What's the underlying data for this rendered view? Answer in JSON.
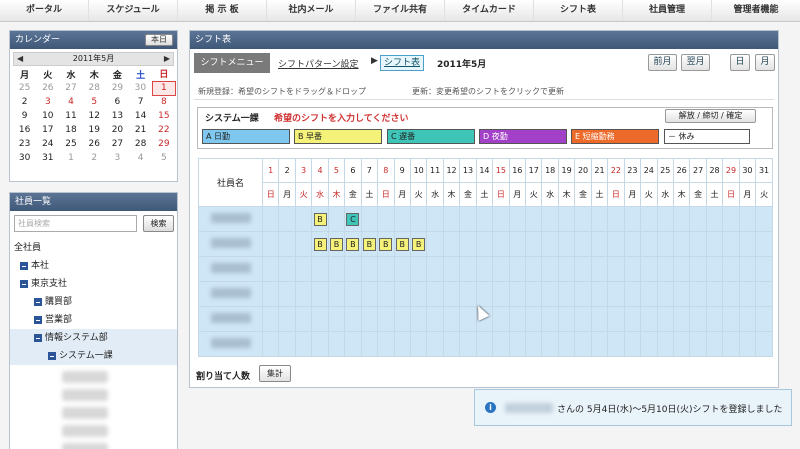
{
  "nav": [
    "ポータル",
    "スケジュール",
    "掲 示 板",
    "社内メール",
    "ファイル共有",
    "タイムカード",
    "シフト表",
    "社員管理",
    "管理者機能"
  ],
  "calendar": {
    "title": "カレンダー",
    "today_btn": "本日",
    "month": "2011年5月",
    "prev": "◀",
    "next": "▶",
    "weekdays": [
      "月",
      "火",
      "水",
      "木",
      "金",
      "土",
      "日"
    ],
    "weeks": [
      [
        "25",
        "26",
        "27",
        "28",
        "29",
        "30",
        "1"
      ],
      [
        "2",
        "3",
        "4",
        "5",
        "6",
        "7",
        "8"
      ],
      [
        "9",
        "10",
        "11",
        "12",
        "13",
        "14",
        "15"
      ],
      [
        "16",
        "17",
        "18",
        "19",
        "20",
        "21",
        "22"
      ],
      [
        "23",
        "24",
        "25",
        "26",
        "27",
        "28",
        "29"
      ],
      [
        "30",
        "31",
        "1",
        "2",
        "3",
        "4",
        "5"
      ]
    ]
  },
  "employees": {
    "title": "社員一覧",
    "search_placeholder": "社員検索",
    "search_btn": "検索",
    "tree": [
      "全社員",
      "本社",
      "東京支社",
      "購買部",
      "営業部",
      "情報システム部",
      "システム一課"
    ]
  },
  "shift": {
    "title": "シフト表",
    "menu": "シフトメニュー",
    "pattern_link": "シフトパターン設定",
    "arrow": "▶",
    "active_tab": "シフト表",
    "month": "2011年5月",
    "prev_month": "前月",
    "next_month": "翌月",
    "day_btn": "日",
    "month_btn": "月",
    "help_new": "新規登録：希望のシフトをドラッグ＆ドロップ",
    "help_update": "更新：変更希望のシフトをクリックで更新",
    "group": "システム一課",
    "instruction": "希望のシフトを入力してください",
    "approve_btn": "解放 / 締切 / 確定",
    "patterns": [
      {
        "label": "A 日勤",
        "color": "#7ec8f0"
      },
      {
        "label": "B 早番",
        "color": "#f5f27a"
      },
      {
        "label": "C 遅番",
        "color": "#3fc4b8"
      },
      {
        "label": "D 夜勤",
        "color": "#a340c8"
      },
      {
        "label": "E 短縮勤務",
        "color": "#ee6a2a"
      },
      {
        "label": "－ 休み",
        "color": "#ffffff"
      }
    ],
    "name_header": "社員名",
    "days": [
      "1",
      "2",
      "3",
      "4",
      "5",
      "6",
      "7",
      "8",
      "9",
      "10",
      "11",
      "12",
      "13",
      "14",
      "15",
      "16",
      "17",
      "18",
      "19",
      "20",
      "21",
      "22",
      "23",
      "24",
      "25",
      "26",
      "27",
      "28",
      "29",
      "30",
      "31"
    ],
    "weekdays": [
      "日",
      "月",
      "火",
      "水",
      "木",
      "金",
      "土",
      "日",
      "月",
      "火",
      "水",
      "木",
      "金",
      "土",
      "日",
      "月",
      "火",
      "水",
      "木",
      "金",
      "土",
      "日",
      "月",
      "火",
      "水",
      "木",
      "金",
      "土",
      "日",
      "月",
      "火"
    ],
    "rows": [
      {
        "cells": {
          "4": "B",
          "6": "C"
        }
      },
      {
        "cells": {
          "4": "B",
          "5": "B",
          "6": "B",
          "7": "B",
          "8": "B",
          "9": "B",
          "10": "B"
        }
      },
      {
        "cells": {}
      },
      {
        "cells": {}
      },
      {
        "cells": {}
      },
      {
        "cells": {}
      }
    ],
    "assign_label": "割り当て人数",
    "calc_btn": "集計"
  },
  "toast": {
    "icon": "i",
    "message": "さんの 5月4日(水)～5月10日(火)シフトを登録しました"
  }
}
